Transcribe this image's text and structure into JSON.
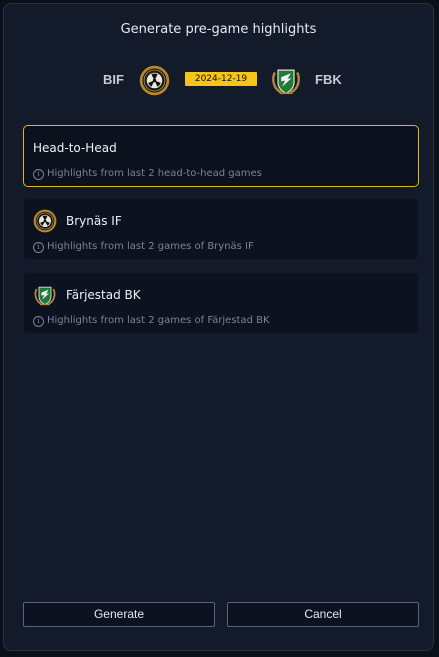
{
  "dialog": {
    "title": "Generate pre-game highlights"
  },
  "matchup": {
    "home_abbr": "BIF",
    "away_abbr": "FBK",
    "date": "2024-12-19",
    "home_logo_icon": "brynas-logo-icon",
    "away_logo_icon": "farjestad-logo-icon"
  },
  "options": [
    {
      "label": "Head-to-Head",
      "description": "Highlights from last 2 head-to-head games",
      "selected": true
    },
    {
      "label": "Brynäs IF",
      "description": "Highlights from last 2 games of Brynäs IF",
      "selected": false,
      "icon": "brynas-logo-icon"
    },
    {
      "label": "Färjestad BK",
      "description": "Highlights from last 2 games of Färjestad BK",
      "selected": false,
      "icon": "farjestad-logo-icon"
    }
  ],
  "info_glyph": "i",
  "buttons": {
    "generate": "Generate",
    "cancel": "Cancel"
  },
  "colors": {
    "accent": "#f5c518",
    "selected_border": "#e2b714",
    "panel": "#131a2a",
    "card": "#0c1220"
  }
}
